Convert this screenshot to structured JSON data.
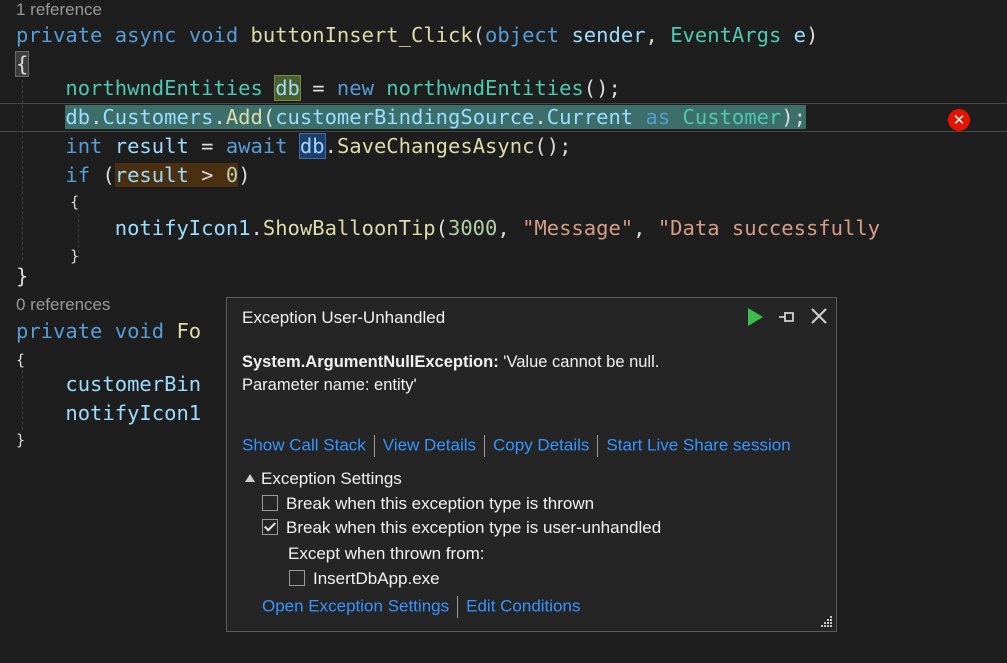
{
  "editor": {
    "lens1": "1 reference",
    "lens2": "0 references",
    "sig1": {
      "private": "private",
      "async": "async",
      "void": "void",
      "name": "buttonInsert_Click",
      "object": "object",
      "sender": "sender",
      "eventargs": "EventArgs",
      "e": "e"
    },
    "line_entities": {
      "type": "northwndEntities",
      "db": "db",
      "new": "new",
      "ctor": "northwndEntities"
    },
    "line_add": {
      "db": "db",
      "customers": "Customers",
      "add": "Add",
      "source": "customerBindingSource",
      "current": "Current",
      "as": "as",
      "customer": "Customer"
    },
    "line_result": {
      "int": "int",
      "result": "result",
      "await": "await",
      "db": "db",
      "save": "SaveChangesAsync"
    },
    "line_if": {
      "if": "if",
      "result": "result",
      "zero": "0"
    },
    "line_notify": {
      "obj": "notifyIcon1",
      "method": "ShowBalloonTip",
      "ms": "3000",
      "s1": "\"Message\"",
      "s2": "\"Data successfully"
    },
    "sig2": {
      "private": "private",
      "void": "void",
      "name": "Fo"
    },
    "line_cbs": "customerBin",
    "line_ni": "notifyIcon1"
  },
  "popup": {
    "title": "Exception User-Unhandled",
    "exception_type": "System.ArgumentNullException:",
    "exception_msg": " 'Value cannot be null.",
    "exception_param": "Parameter name: entity'",
    "links": [
      "Show Call Stack",
      "View Details",
      "Copy Details",
      "Start Live Share session"
    ],
    "settings_header": "Exception Settings",
    "opt_thrown": "Break when this exception type is thrown",
    "opt_unhandled": "Break when this exception type is user-unhandled",
    "except_label": "Except when thrown from:",
    "except_module": "InsertDbApp.exe",
    "bottom_links": [
      "Open Exception Settings",
      "Edit Conditions"
    ],
    "checked": {
      "thrown": false,
      "unhandled": true,
      "module": false
    }
  }
}
